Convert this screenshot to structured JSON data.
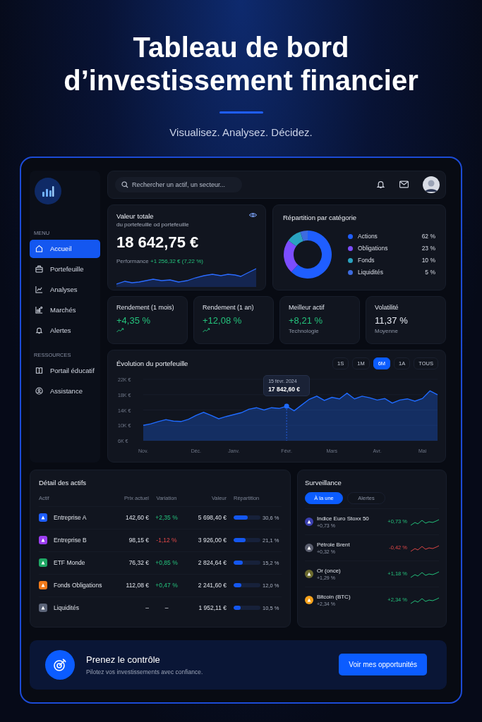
{
  "header": {
    "title": "Tableau de bord d’investissement financier",
    "subtitle": "Visualisez. Analysez. Décidez."
  },
  "search": {
    "placeholder": "Rechercher un actif, un secteur..."
  },
  "sidebar": {
    "sections": [
      {
        "heading": "MENU",
        "items": [
          {
            "label": "Accueil",
            "selected": true
          },
          {
            "label": "Portefeuille",
            "selected": false
          },
          {
            "label": "Analyses",
            "selected": false
          },
          {
            "label": "Marchés",
            "selected": false
          },
          {
            "label": "Alertes",
            "selected": false
          }
        ]
      },
      {
        "heading": "RESSOURCES",
        "items": [
          {
            "label": "Portail éducatif",
            "selected": false
          },
          {
            "label": "Assistance",
            "selected": false
          }
        ]
      }
    ]
  },
  "total": {
    "title": "Valeur totale",
    "subtitle": "du portefeuille od portefeuille",
    "value": "18 642,75 €",
    "performance_label": "Performance",
    "performance_value": "+1 256,32 € (7,22 %)"
  },
  "allocation": {
    "title": "Répartition par catégorie",
    "chart_data": {
      "type": "donut",
      "categories": [
        "Actions",
        "Obligations",
        "Fonds",
        "Liquidités"
      ],
      "values": [
        62,
        23,
        10,
        5
      ]
    },
    "legend": [
      {
        "value": "62 %",
        "color": "#1f5eff"
      },
      {
        "value": "23 %",
        "color": "#7c4dff"
      },
      {
        "value": "10 %",
        "color": "#2aa3c0"
      },
      {
        "value": "5 %",
        "color": "#3d6be0"
      }
    ]
  },
  "kpis": [
    {
      "kind": "trend",
      "label": "Rendement (1 mois)",
      "value": "+4,35 %",
      "positive": true
    },
    {
      "kind": "trend",
      "label": "Rendement (1 an)",
      "value": "+12,08 %",
      "positive": true
    },
    {
      "kind": "note",
      "label": "Meilleur actif",
      "value": "+8,21 %",
      "positive": true,
      "note": "Technologie"
    },
    {
      "kind": "note",
      "label": "Volatilité",
      "value": "11,37 %",
      "positive": false,
      "note": "Moyenne"
    }
  ],
  "evolution": {
    "title": "Évolution du portefeuille",
    "periods": [
      {
        "label": "1S",
        "selected": false
      },
      {
        "label": "1M",
        "selected": false
      },
      {
        "label": "6M",
        "selected": true
      },
      {
        "label": "1A",
        "selected": false
      },
      {
        "label": "TOUS",
        "selected": false
      }
    ],
    "tooltip": {
      "date": "15 févr. 2024",
      "value": "17 842,60 €"
    },
    "chart_data": {
      "type": "area",
      "grid": true,
      "ylim": [
        6000,
        22000
      ],
      "categories": [
        "Nov.",
        null,
        null,
        null,
        null,
        null,
        null,
        "Déc.",
        null,
        null,
        null,
        null,
        "Janv.",
        null,
        null,
        null,
        null,
        null,
        null,
        "Févr.",
        null,
        null,
        null,
        null,
        null,
        "Mars",
        null,
        null,
        null,
        null,
        null,
        "Avr.",
        null,
        null,
        null,
        null,
        null,
        "Mai",
        null,
        null
      ],
      "yticks": [
        {
          "value": 6000,
          "label": "6K €"
        },
        {
          "value": 10000,
          "label": "10K €"
        },
        {
          "value": 14000,
          "label": "14K €"
        },
        {
          "value": 18000,
          "label": "18K €"
        },
        {
          "value": 22000,
          "label": "22K €"
        }
      ],
      "series": [
        {
          "color": "#1f6bff",
          "values": [
            10000,
            10400,
            11000,
            11500,
            11100,
            11000,
            11600,
            12600,
            13400,
            12600,
            11700,
            12300,
            12800,
            13300,
            14200,
            14600,
            14000,
            14600,
            14400,
            15000,
            13800,
            15300,
            16800,
            17600,
            16500,
            17300,
            16900,
            18400,
            16900,
            17600,
            17200,
            16600,
            17000,
            15800,
            16600,
            16900,
            16300,
            17000,
            19000,
            18000
          ]
        }
      ],
      "annotations": [
        {
          "x": "Févr."
        }
      ]
    }
  },
  "assets": {
    "title": "Détail des actifs",
    "columns": [
      "Actif",
      "Prix actuel",
      "Variation",
      "Valeur",
      "Répartition"
    ],
    "rows": [
      {
        "name": "Entreprise A",
        "color": "#1f5eff",
        "price": "142,60 €",
        "variation": "+2,35 %",
        "positive": true,
        "negative": false,
        "value": "5 698,40 €",
        "share": "30,6 %",
        "level": 0.53
      },
      {
        "name": "Entreprise B",
        "color": "#9b3df0",
        "price": "98,15 €",
        "variation": "-1,12 %",
        "positive": false,
        "negative": true,
        "value": "3 926,00 €",
        "share": "21,1 %",
        "level": 0.44
      },
      {
        "name": "ETF Monde",
        "color": "#1fa865",
        "price": "76,32 €",
        "variation": "+0,85 %",
        "positive": true,
        "negative": false,
        "value": "2 824,64 €",
        "share": "15,2 %",
        "level": 0.35
      },
      {
        "name": "Fonds Obligations",
        "color": "#f07a1a",
        "price": "112,08 €",
        "variation": "+0,47 %",
        "positive": true,
        "negative": false,
        "value": "2 241,60 €",
        "share": "12,0 %",
        "level": 0.29
      },
      {
        "name": "Liquidités",
        "color": "#5b6478",
        "price": "–",
        "variation": "–",
        "positive": false,
        "negative": false,
        "value": "1 952,11 €",
        "share": "10,5 %",
        "level": 0.25
      }
    ]
  },
  "watchlist": {
    "title": "Surveillance",
    "tabs": [
      {
        "label": "À la une",
        "selected": true
      },
      {
        "label": "Alertes",
        "selected": false
      }
    ],
    "items": [
      {
        "name": "Indice Euro Stoxx 50",
        "sub": "+0,73 %",
        "change": "+0,73 %",
        "rising": true,
        "color": "#3a3fb0"
      },
      {
        "name": "Pétrole Brent",
        "sub": "+0,32 %",
        "change": "-0,42 %",
        "rising": false,
        "color": "#5a5e6e"
      },
      {
        "name": "Or (once)",
        "sub": "+1,29 %",
        "change": "+1,18 %",
        "rising": true,
        "color": "#6b6a2e"
      },
      {
        "name": "Bitcoin (BTC)",
        "sub": "+2,34 %",
        "change": "+2,34 %",
        "rising": true,
        "color": "#f7a21b"
      }
    ]
  },
  "banner": {
    "title": "Prenez le contrôle",
    "text": "Pilotez vos investissements avec confiance.",
    "button": "Voir mes opportunités"
  }
}
